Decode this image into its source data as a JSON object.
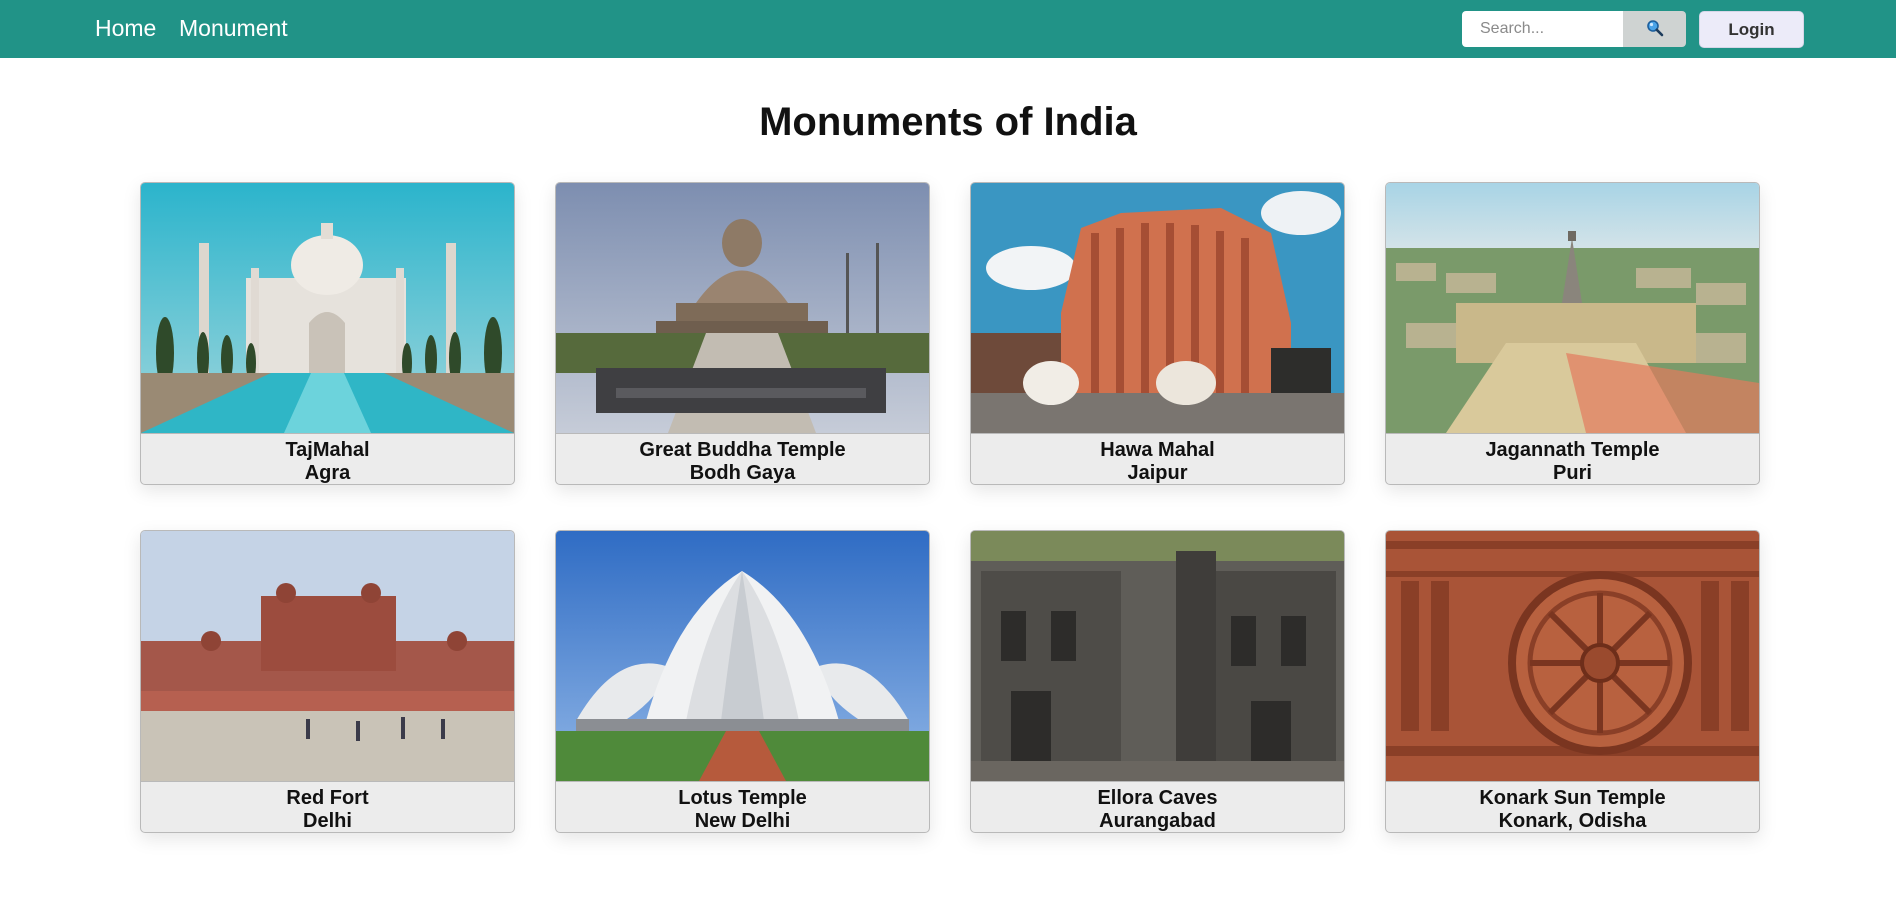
{
  "nav": {
    "home": "Home",
    "monument": "Monument",
    "search_placeholder": "Search...",
    "search_icon": "magnifying-glass",
    "login": "Login"
  },
  "page_title": "Monuments of India",
  "cards": [
    {
      "name": "TajMahal",
      "location": "Agra"
    },
    {
      "name": "Great Buddha Temple",
      "location": "Bodh Gaya"
    },
    {
      "name": "Hawa Mahal",
      "location": "Jaipur"
    },
    {
      "name": "Jagannath Temple",
      "location": "Puri"
    },
    {
      "name": "Red Fort",
      "location": "Delhi"
    },
    {
      "name": "Lotus Temple",
      "location": "New Delhi"
    },
    {
      "name": "Ellora Caves",
      "location": "Aurangabad"
    },
    {
      "name": "Konark Sun Temple",
      "location": "Konark, Odisha"
    }
  ],
  "colors": {
    "navbar": "#219387",
    "login_bg": "#ecebf9",
    "caption_bg": "#ececec"
  }
}
